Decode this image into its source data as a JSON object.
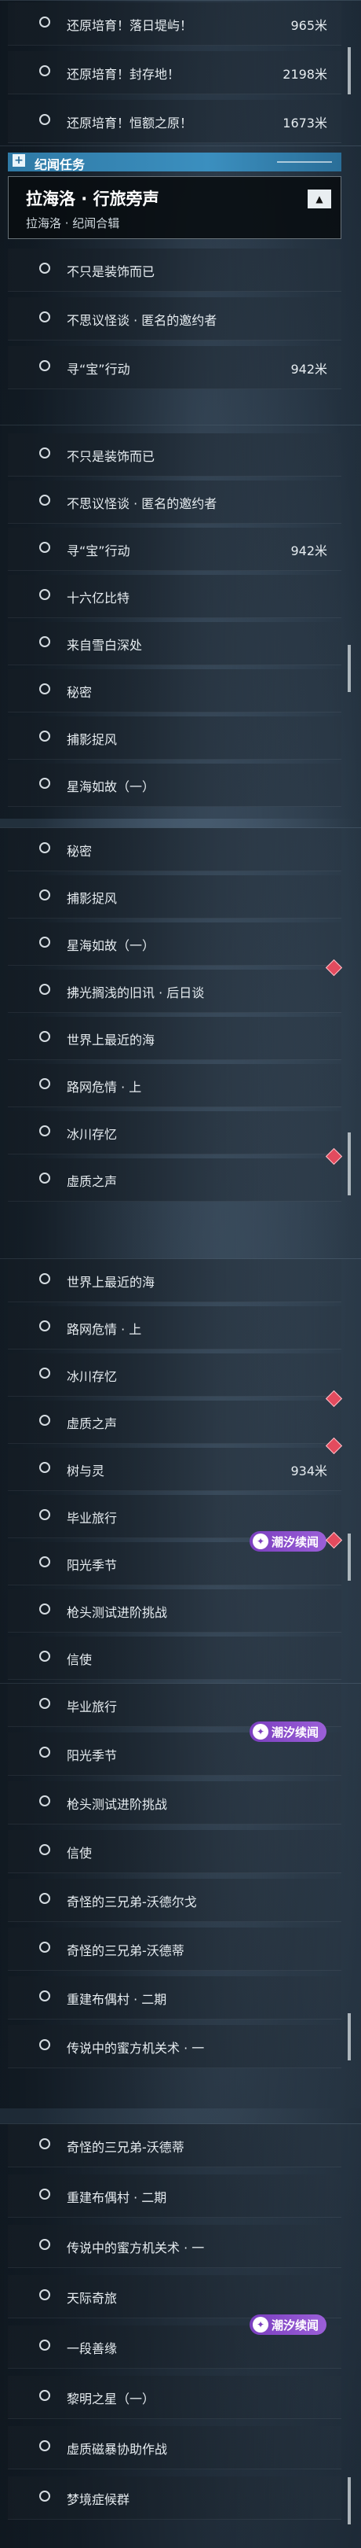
{
  "section_header": {
    "title": "纪闻任务",
    "expand_symbol": "+"
  },
  "track": {
    "title": "拉海洛 · 行旅旁声",
    "subtitle": "拉海洛 · 纪闻合辑",
    "collapse_symbol": "▲"
  },
  "tag_label": "潮汐续闻",
  "tag_icon": "✦",
  "panels": [
    {
      "rows": [
        {
          "label": "还原培育！落日堤屿！",
          "distance": "965米"
        },
        {
          "label": "还原培育！封存地！",
          "distance": "2198米"
        },
        {
          "label": "还原培育！恒额之原！",
          "distance": "1673米"
        }
      ]
    },
    {
      "rows": [
        {
          "label": "不只是装饰而已",
          "distance": ""
        },
        {
          "label": "不思议怪谈 · 匿名的邀约者",
          "distance": ""
        },
        {
          "label": "寻“宝”行动",
          "distance": "942米"
        }
      ]
    },
    {
      "rows": [
        {
          "label": "不只是装饰而已",
          "distance": ""
        },
        {
          "label": "不思议怪谈 · 匿名的邀约者",
          "distance": ""
        },
        {
          "label": "寻“宝”行动",
          "distance": "942米"
        },
        {
          "label": "十六亿比特",
          "distance": ""
        },
        {
          "label": "来自雪白深处",
          "distance": ""
        },
        {
          "label": "秘密",
          "distance": ""
        },
        {
          "label": "捕影捉风",
          "distance": ""
        },
        {
          "label": "星海如故（一）",
          "distance": ""
        }
      ]
    },
    {
      "rows": [
        {
          "label": "秘密",
          "distance": ""
        },
        {
          "label": "捕影捉风",
          "distance": ""
        },
        {
          "label": "星海如故（一）",
          "distance": ""
        },
        {
          "label": "拂光搁浅的旧讯 · 后日谈",
          "distance": ""
        },
        {
          "label": "世界上最近的海",
          "distance": ""
        },
        {
          "label": "路网危情 · 上",
          "distance": ""
        },
        {
          "label": "冰川存忆",
          "distance": ""
        },
        {
          "label": "虚质之声",
          "distance": ""
        }
      ]
    },
    {
      "rows": [
        {
          "label": "世界上最近的海",
          "distance": ""
        },
        {
          "label": "路网危情 · 上",
          "distance": ""
        },
        {
          "label": "冰川存忆",
          "distance": ""
        },
        {
          "label": "虚质之声",
          "distance": ""
        },
        {
          "label": "树与灵",
          "distance": "934米"
        },
        {
          "label": "毕业旅行",
          "distance": ""
        },
        {
          "label": "阳光季节",
          "distance": ""
        },
        {
          "label": "枪头测试进阶挑战",
          "distance": ""
        },
        {
          "label": "信使",
          "distance": ""
        }
      ]
    },
    {
      "rows": [
        {
          "label": "毕业旅行",
          "distance": ""
        },
        {
          "label": "阳光季节",
          "distance": ""
        },
        {
          "label": "枪头测试进阶挑战",
          "distance": ""
        },
        {
          "label": "信使",
          "distance": ""
        },
        {
          "label": "奇怪的三兄弟-沃德尔戈",
          "distance": ""
        },
        {
          "label": "奇怪的三兄弟-沃德蒂",
          "distance": ""
        },
        {
          "label": "重建布偶村 · 二期",
          "distance": ""
        },
        {
          "label": "传说中的蜜方机关术 · 一",
          "distance": ""
        }
      ]
    },
    {
      "rows": [
        {
          "label": "奇怪的三兄弟-沃德蒂",
          "distance": ""
        },
        {
          "label": "重建布偶村 · 二期",
          "distance": ""
        },
        {
          "label": "传说中的蜜方机关术 · 一",
          "distance": ""
        },
        {
          "label": "天际奇旅",
          "distance": ""
        },
        {
          "label": "一段善缘",
          "distance": ""
        },
        {
          "label": "黎明之星（一）",
          "distance": ""
        },
        {
          "label": "虚质磁暴协助作战",
          "distance": ""
        },
        {
          "label": "梦境症候群",
          "distance": ""
        }
      ]
    }
  ]
}
